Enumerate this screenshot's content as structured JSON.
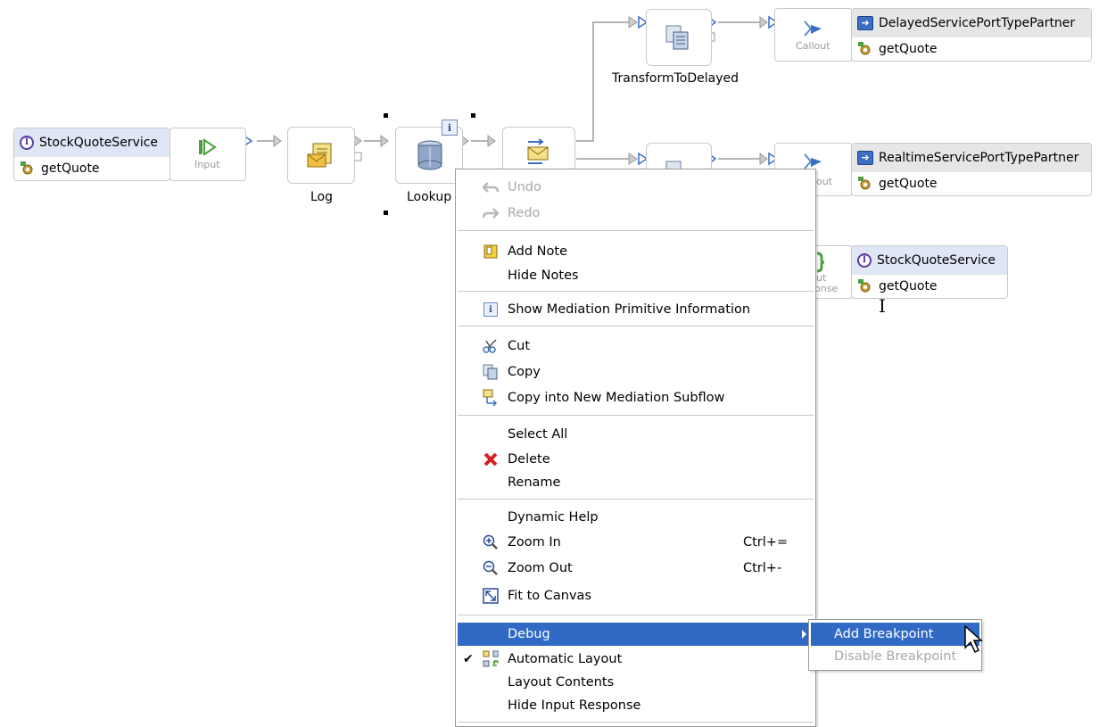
{
  "canvas": {
    "service_left": {
      "interface": "StockQuoteService",
      "operation": "getQuote"
    },
    "input_node": {
      "label": "Input"
    },
    "log_node": {
      "label": "Log"
    },
    "lookup_node": {
      "label": "Lookup"
    },
    "transform_delayed": {
      "label": "TransformToDelayed"
    },
    "callout_delayed": {
      "label": "Callout"
    },
    "callout_realtime": {
      "label": "out"
    },
    "input_response_node": {
      "label_a": "ut",
      "label_b": "onse"
    },
    "partner_delayed": {
      "interface": "DelayedServicePortTypePartner",
      "operation": "getQuote"
    },
    "partner_realtime": {
      "interface": "RealtimeServicePortTypePartner",
      "operation": "getQuote"
    },
    "service_right": {
      "interface": "StockQuoteService",
      "operation": "getQuote"
    },
    "info_badge": "i"
  },
  "context_menu": {
    "undo": "Undo",
    "redo": "Redo",
    "add_note": "Add Note",
    "hide_notes": "Hide Notes",
    "show_info": "Show Mediation Primitive Information",
    "cut": "Cut",
    "copy": "Copy",
    "copy_subflow": "Copy into New Mediation Subflow",
    "select_all": "Select All",
    "delete": "Delete",
    "rename": "Rename",
    "dynamic_help": "Dynamic Help",
    "zoom_in": "Zoom In",
    "zoom_in_shortcut": "Ctrl+=",
    "zoom_out": "Zoom Out",
    "zoom_out_shortcut": "Ctrl+-",
    "fit_canvas": "Fit to Canvas",
    "debug": "Debug",
    "automatic_layout": "Automatic Layout",
    "automatic_layout_checked": "✔",
    "layout_contents": "Layout Contents",
    "hide_input_response": "Hide Input Response"
  },
  "debug_submenu": {
    "add_breakpoint": "Add Breakpoint",
    "disable_breakpoint": "Disable Breakpoint"
  },
  "colors": {
    "menu_highlight": "#316ac5",
    "interface_header": "#dfe6f5",
    "partner_header": "#e6e6e6"
  }
}
